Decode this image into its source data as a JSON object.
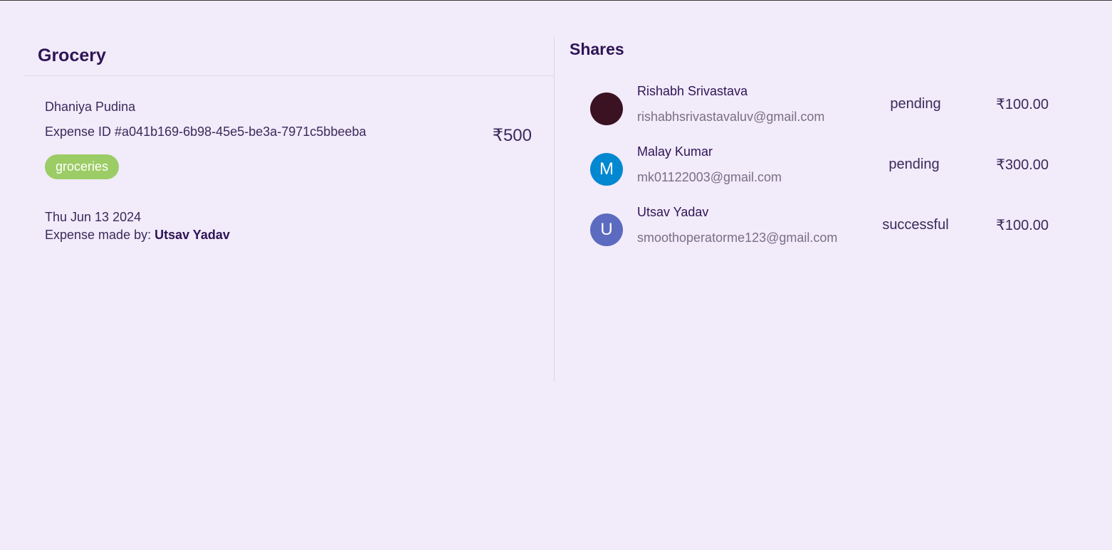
{
  "expense": {
    "title": "Grocery",
    "description": "Dhaniya Pudina",
    "id_text": "Expense ID #a041b169-6b98-45e5-be3a-7971c5bbeeba",
    "amount": "₹500",
    "tag": "groceries",
    "date": "Thu Jun 13 2024",
    "made_by_label": "Expense made by:",
    "made_by_name": "Utsav Yadav"
  },
  "shares": {
    "title": "Shares",
    "items": [
      {
        "name": "Rishabh Srivastava",
        "email": "rishabhsrivastavaluv@gmail.com",
        "status": "pending",
        "amount": "₹100.00",
        "initial": "",
        "avatar_color": "#3a1222"
      },
      {
        "name": "Malay Kumar",
        "email": "mk01122003@gmail.com",
        "status": "pending",
        "amount": "₹300.00",
        "initial": "M",
        "avatar_color": "#0288d1"
      },
      {
        "name": "Utsav Yadav",
        "email": "smoothoperatorme123@gmail.com",
        "status": "successful",
        "amount": "₹100.00",
        "initial": "U",
        "avatar_color": "#5c6bc0"
      }
    ]
  },
  "colors": {
    "background": "#f2ebfa",
    "tag": "#9ccc65",
    "heading": "#2e1555"
  }
}
